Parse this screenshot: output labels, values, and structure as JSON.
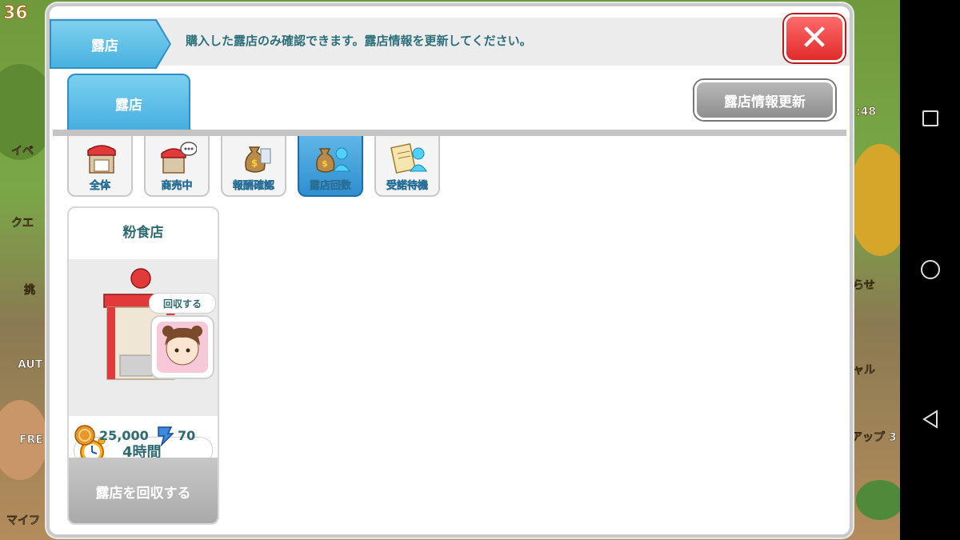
{
  "background": {
    "level": "36",
    "labels": [
      "イベ",
      "クエ",
      "挑",
      "AUT",
      "FRE",
      "マイフ",
      "アップ 3",
      "ャル",
      "らせ",
      ":48"
    ]
  },
  "header": {
    "title": "露店",
    "message": "購入した露店のみ確認できます。露店情報を更新してください。",
    "close_symbol": "✕"
  },
  "tab": {
    "label": "露店"
  },
  "refresh_button": {
    "label": "露店情報更新"
  },
  "filters": [
    {
      "label": "全体",
      "active": false,
      "icon": "stall-icon"
    },
    {
      "label": "商売中",
      "active": false,
      "icon": "stall-chat-icon"
    },
    {
      "label": "報酬確認",
      "active": false,
      "icon": "money-bag-icon"
    },
    {
      "label": "露店回数",
      "active": true,
      "icon": "money-bag-person-icon"
    },
    {
      "label": "受諾待機",
      "active": false,
      "icon": "clipboard-person-icon"
    }
  ],
  "stall_card": {
    "title": "粉食店",
    "bubble_text": "回収する",
    "timer": "4時間",
    "price_coins": "25,000",
    "price_gems": "70",
    "collect_label": "露店を回収する"
  },
  "colors": {
    "accent_blue": "#45aee0",
    "close_red": "#e02a2a",
    "text_teal": "#2f6a73"
  }
}
